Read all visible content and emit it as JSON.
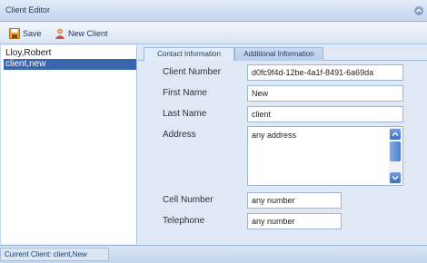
{
  "window": {
    "title": "Client Editor",
    "collapse_icon": "chevron-up-icon"
  },
  "toolbar": {
    "save_label": "Save",
    "save_icon": "floppy-disk-icon",
    "new_client_label": "New Client",
    "new_client_icon": "add-user-icon"
  },
  "client_list": {
    "items": [
      {
        "label": "Lloy,Robert",
        "selected": false
      },
      {
        "label": "client,new",
        "selected": true
      }
    ]
  },
  "tabs": [
    {
      "label": "Contact Information",
      "active": true
    },
    {
      "label": "Additional Information",
      "active": false
    }
  ],
  "form": {
    "client_number": {
      "label": "Client Number",
      "value": "d0fc9f4d-12be-4a1f-8491-6a69da"
    },
    "first_name": {
      "label": "First Name",
      "value": "New"
    },
    "last_name": {
      "label": "Last Name",
      "value": "client"
    },
    "address": {
      "label": "Address",
      "value": "any address"
    },
    "cell_number": {
      "label": "Cell Number",
      "value": "any number"
    },
    "telephone": {
      "label": "Telephone",
      "value": "any number"
    }
  },
  "status": {
    "text": "Current Client: client,New"
  },
  "colors": {
    "accent": "#3a66b0",
    "tab_active": "#e3ecf7",
    "toolbar": "#d8e4f3"
  }
}
